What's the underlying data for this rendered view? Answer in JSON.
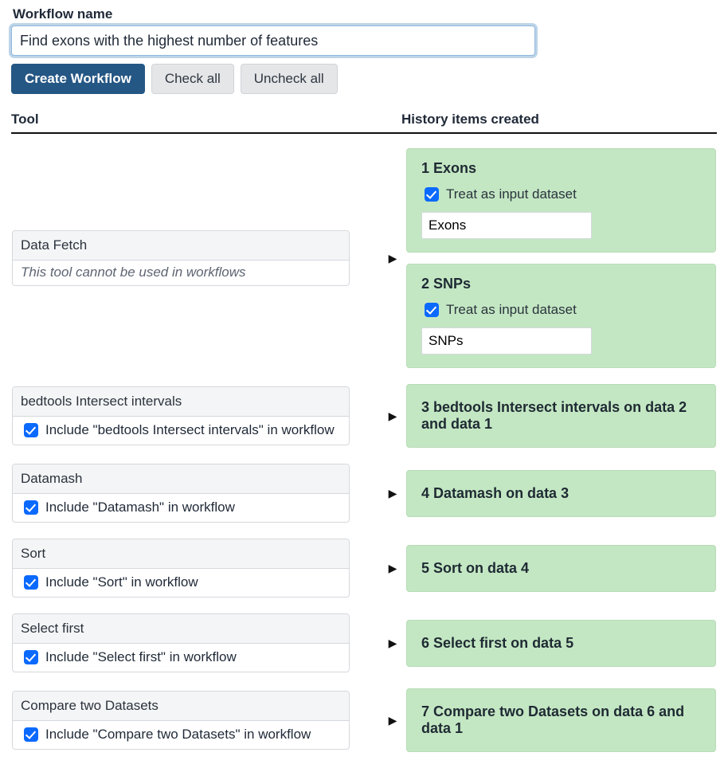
{
  "form": {
    "label": "Workflow name",
    "value": "Find exons with the highest number of features"
  },
  "buttons": {
    "create": "Create Workflow",
    "checkAll": "Check all",
    "uncheckAll": "Uncheck all"
  },
  "columns": {
    "tool": "Tool",
    "history": "History items created"
  },
  "arrow": "▶",
  "rows": [
    {
      "tool": {
        "name": "Data Fetch",
        "disabledNote": "This tool cannot be used in workflows"
      },
      "history": [
        {
          "index": "1",
          "title": "Exons",
          "treatLabel": "Treat as input dataset",
          "inputName": "Exons"
        },
        {
          "index": "2",
          "title": "SNPs",
          "treatLabel": "Treat as input dataset",
          "inputName": "SNPs"
        }
      ]
    },
    {
      "tool": {
        "name": "bedtools Intersect intervals",
        "includeLabel": "Include \"bedtools Intersect intervals\" in workflow"
      },
      "history": [
        {
          "index": "3",
          "title": "bedtools Intersect intervals on data 2 and data 1"
        }
      ]
    },
    {
      "tool": {
        "name": "Datamash",
        "includeLabel": "Include \"Datamash\" in workflow"
      },
      "history": [
        {
          "index": "4",
          "title": "Datamash on data 3"
        }
      ]
    },
    {
      "tool": {
        "name": "Sort",
        "includeLabel": "Include \"Sort\" in workflow"
      },
      "history": [
        {
          "index": "5",
          "title": "Sort on data 4"
        }
      ]
    },
    {
      "tool": {
        "name": "Select first",
        "includeLabel": "Include \"Select first\" in workflow"
      },
      "history": [
        {
          "index": "6",
          "title": "Select first on data 5"
        }
      ]
    },
    {
      "tool": {
        "name": "Compare two Datasets",
        "includeLabel": "Include \"Compare two Datasets\" in workflow"
      },
      "history": [
        {
          "index": "7",
          "title": "Compare two Datasets on data 6 and data 1"
        }
      ]
    }
  ]
}
